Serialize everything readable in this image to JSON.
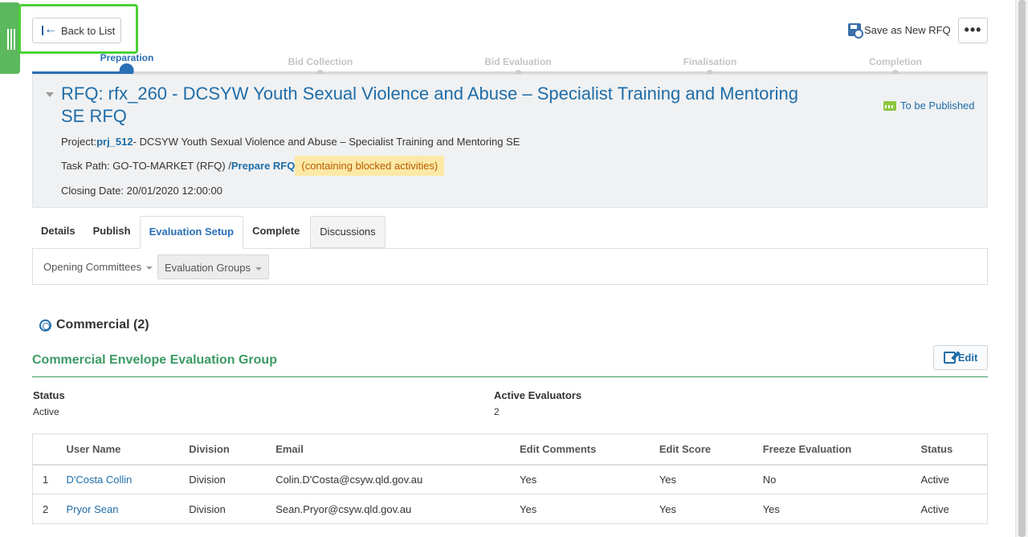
{
  "toolbar": {
    "back_label": "Back to List",
    "save_new_label": "Save as New RFQ",
    "more_label": "•••"
  },
  "steps": [
    {
      "label": "Preparation",
      "state": "active"
    },
    {
      "label": "Bid Collection",
      "state": "inactive"
    },
    {
      "label": "Bid Evaluation",
      "state": "inactive"
    },
    {
      "label": "Finalisation",
      "state": "inactive"
    },
    {
      "label": "Completion",
      "state": "inactive"
    }
  ],
  "rfq": {
    "title": "RFQ: rfx_260 - DCSYW Youth Sexual Violence and Abuse – Specialist Training and Mentoring SE RFQ",
    "status": "To be Published",
    "project_label": "Project:",
    "project_code": "prj_512",
    "project_name": "- DCSYW Youth Sexual Violence and Abuse – Specialist Training and Mentoring SE",
    "task_path_label": "Task Path: GO-TO-MARKET (RFQ) /",
    "task_path_link": "Prepare RFQ",
    "blocked_note": "(containing blocked activities)",
    "closing_date": "Closing Date: 20/01/2020 12:00:00"
  },
  "tabs": [
    "Details",
    "Publish",
    "Evaluation Setup",
    "Complete",
    "Discussions"
  ],
  "subnav": [
    "Opening Committees",
    "Evaluation Groups"
  ],
  "envelope": {
    "title": "Commercial (2)"
  },
  "group": {
    "title": "Commercial Envelope Evaluation Group",
    "edit_label": "Edit",
    "status_label": "Status",
    "status_value": "Active",
    "evaluators_label": "Active Evaluators",
    "evaluators_value": "2"
  },
  "table": {
    "headers": [
      "",
      "User Name",
      "Division",
      "Email",
      "Edit Comments",
      "Edit Score",
      "Freeze Evaluation",
      "Status"
    ],
    "rows": [
      [
        "1",
        "D'Costa Collin",
        "Division",
        "Colin.D'Costa@csyw.qld.gov.au",
        "Yes",
        "Yes",
        "No",
        "Active"
      ],
      [
        "2",
        "Pryor Sean",
        "Division",
        "Sean.Pryor@csyw.qld.gov.au",
        "Yes",
        "Yes",
        "Yes",
        "Active"
      ]
    ]
  },
  "colors": {
    "accent": "#2a6fb5",
    "group_green": "#3b9a62",
    "highlight": "#4cd137",
    "handle": "#5cb85c",
    "blocked_bg": "#fce9a6"
  }
}
